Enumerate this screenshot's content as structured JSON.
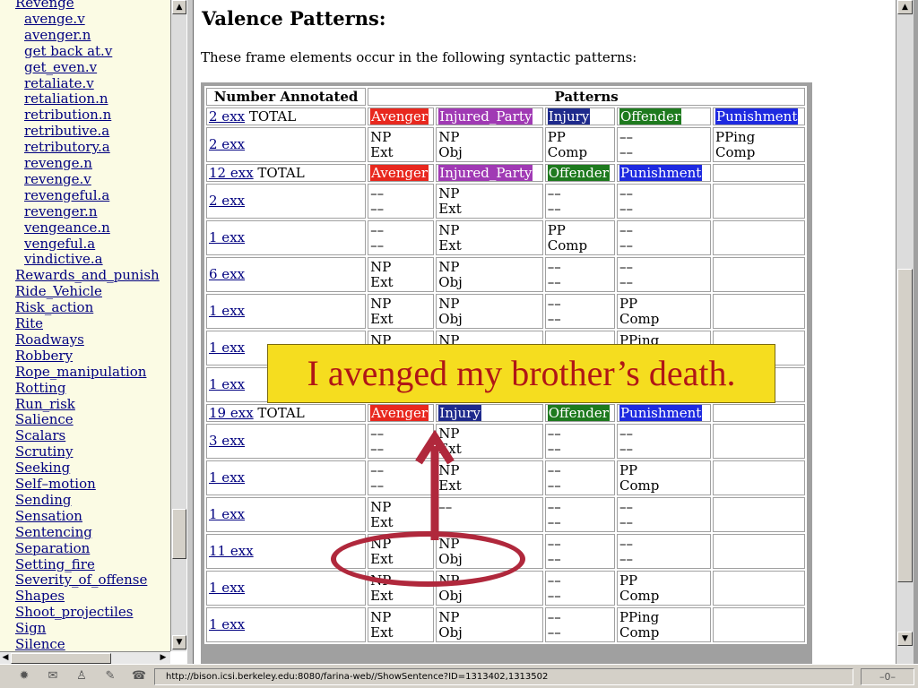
{
  "sidebar": {
    "items": [
      {
        "label": "Revenge",
        "sub": false
      },
      {
        "label": "avenge.v",
        "sub": true
      },
      {
        "label": "avenger.n",
        "sub": true
      },
      {
        "label": "get back at.v",
        "sub": true
      },
      {
        "label": "get_even.v",
        "sub": true
      },
      {
        "label": "retaliate.v",
        "sub": true
      },
      {
        "label": "retaliation.n",
        "sub": true
      },
      {
        "label": "retribution.n",
        "sub": true
      },
      {
        "label": "retributive.a",
        "sub": true
      },
      {
        "label": "retributory.a",
        "sub": true
      },
      {
        "label": "revenge.n",
        "sub": true
      },
      {
        "label": "revenge.v",
        "sub": true
      },
      {
        "label": "revengeful.a",
        "sub": true
      },
      {
        "label": "revenger.n",
        "sub": true
      },
      {
        "label": "vengeance.n",
        "sub": true
      },
      {
        "label": "vengeful.a",
        "sub": true
      },
      {
        "label": "vindictive.a",
        "sub": true
      },
      {
        "label": "Rewards_and_punish",
        "sub": false
      },
      {
        "label": "Ride_Vehicle",
        "sub": false
      },
      {
        "label": "Risk_action",
        "sub": false
      },
      {
        "label": "Rite",
        "sub": false
      },
      {
        "label": "Roadways",
        "sub": false
      },
      {
        "label": "Robbery",
        "sub": false
      },
      {
        "label": "Rope_manipulation",
        "sub": false
      },
      {
        "label": "Rotting",
        "sub": false
      },
      {
        "label": "Run_risk",
        "sub": false
      },
      {
        "label": "Salience",
        "sub": false
      },
      {
        "label": "Scalars",
        "sub": false
      },
      {
        "label": "Scrutiny",
        "sub": false
      },
      {
        "label": "Seeking",
        "sub": false
      },
      {
        "label": "Self–motion",
        "sub": false
      },
      {
        "label": "Sending",
        "sub": false
      },
      {
        "label": "Sensation",
        "sub": false
      },
      {
        "label": "Sentencing",
        "sub": false
      },
      {
        "label": "Separation",
        "sub": false
      },
      {
        "label": "Setting_fire",
        "sub": false
      },
      {
        "label": "Severity_of_offense",
        "sub": false
      },
      {
        "label": "Shapes",
        "sub": false
      },
      {
        "label": "Shoot_projectiles",
        "sub": false
      },
      {
        "label": "Sign",
        "sub": false
      },
      {
        "label": "Silence",
        "sub": false
      }
    ]
  },
  "main": {
    "title": "Valence Patterns:",
    "intro": "These frame elements occur in the following syntactic patterns:",
    "table": {
      "head_count": "Number Annotated",
      "head_patterns": "Patterns",
      "fe_colors": {
        "Avenger": "#e8281e",
        "Injured_Party": "#a03ab4",
        "Injury": "#1e2a8c",
        "Offender": "#1e7a1e",
        "Punishment": "#1e2ae0"
      },
      "rows": [
        {
          "kind": "sum",
          "link": "2 exx",
          "extra": " TOTAL",
          "cells": [
            "Avenger",
            "Injured_Party",
            "Injury",
            "Offender",
            "Punishment"
          ]
        },
        {
          "kind": "row",
          "link": "2 exx",
          "cells": [
            [
              "NP",
              "Ext"
            ],
            [
              "NP",
              "Obj"
            ],
            [
              "PP",
              "Comp"
            ],
            [
              "––",
              "––"
            ],
            [
              "PPing",
              "Comp"
            ]
          ]
        },
        {
          "kind": "sum",
          "link": "12 exx",
          "extra": " TOTAL",
          "cells": [
            "Avenger",
            "Injured_Party",
            "Offender",
            "Punishment",
            ""
          ]
        },
        {
          "kind": "row",
          "link": "2 exx",
          "cells": [
            [
              "––",
              "––"
            ],
            [
              "NP",
              "Ext"
            ],
            [
              "––",
              "––"
            ],
            [
              "––",
              "––"
            ],
            [
              "",
              ""
            ]
          ]
        },
        {
          "kind": "row",
          "link": "1 exx",
          "cells": [
            [
              "––",
              "––"
            ],
            [
              "NP",
              "Ext"
            ],
            [
              "PP",
              "Comp"
            ],
            [
              "––",
              "––"
            ],
            [
              "",
              ""
            ]
          ]
        },
        {
          "kind": "row",
          "link": "6 exx",
          "cells": [
            [
              "NP",
              "Ext"
            ],
            [
              "NP",
              "Obj"
            ],
            [
              "––",
              "––"
            ],
            [
              "––",
              "––"
            ],
            [
              "",
              ""
            ]
          ]
        },
        {
          "kind": "row",
          "link": "1 exx",
          "cells": [
            [
              "NP",
              "Ext"
            ],
            [
              "NP",
              "Obj"
            ],
            [
              "––",
              "––"
            ],
            [
              "PP",
              "Comp"
            ],
            [
              "",
              ""
            ]
          ]
        },
        {
          "kind": "row",
          "link": "1 exx",
          "cells": [
            [
              "NP",
              ""
            ],
            [
              "NP",
              ""
            ],
            [
              "",
              ""
            ],
            [
              "PPing",
              ""
            ],
            [
              "",
              ""
            ]
          ]
        },
        {
          "kind": "row",
          "link": "1 exx",
          "cells": [
            [
              "",
              ""
            ],
            [
              "",
              ""
            ],
            [
              "",
              ""
            ],
            [
              "",
              ""
            ],
            [
              "",
              ""
            ]
          ]
        },
        {
          "kind": "sum",
          "link": "19 exx",
          "extra": " TOTAL",
          "cells": [
            "Avenger",
            "Injury",
            "Offender",
            "Punishment",
            ""
          ]
        },
        {
          "kind": "row",
          "link": "3 exx",
          "cells": [
            [
              "––",
              "––"
            ],
            [
              "NP",
              "Ext"
            ],
            [
              "––",
              "––"
            ],
            [
              "––",
              "––"
            ],
            [
              "",
              ""
            ]
          ]
        },
        {
          "kind": "row",
          "link": "1 exx",
          "cells": [
            [
              "––",
              "––"
            ],
            [
              "NP",
              "Ext"
            ],
            [
              "––",
              "––"
            ],
            [
              "PP",
              "Comp"
            ],
            [
              "",
              ""
            ]
          ]
        },
        {
          "kind": "row",
          "link": "1 exx",
          "cells": [
            [
              "NP",
              "Ext"
            ],
            [
              "––",
              ""
            ],
            [
              "––",
              "––"
            ],
            [
              "––",
              "––"
            ],
            [
              "",
              ""
            ]
          ]
        },
        {
          "kind": "row",
          "link": "11 exx",
          "cells": [
            [
              "NP",
              "Ext"
            ],
            [
              "NP",
              "Obj"
            ],
            [
              "––",
              "––"
            ],
            [
              "––",
              "––"
            ],
            [
              "",
              ""
            ]
          ]
        },
        {
          "kind": "row",
          "link": "1 exx",
          "cells": [
            [
              "NP",
              "Ext"
            ],
            [
              "NP",
              "Obj"
            ],
            [
              "––",
              "––"
            ],
            [
              "PP",
              "Comp"
            ],
            [
              "",
              ""
            ]
          ]
        },
        {
          "kind": "row",
          "link": "1 exx",
          "cells": [
            [
              "NP",
              "Ext"
            ],
            [
              "NP",
              "Obj"
            ],
            [
              "––",
              "––"
            ],
            [
              "PPing",
              "Comp"
            ],
            [
              "",
              ""
            ]
          ]
        }
      ]
    }
  },
  "overlay": {
    "caption": "I avenged my brother’s death.",
    "highlight_color": "#b0283c",
    "caption_bg": "#f5dd1f"
  },
  "status": {
    "url": "http://bison.icsi.berkeley.edu:8080/farina-web//ShowSentence?ID=1313402,1313502",
    "connection": "–0–",
    "icons": [
      "netscape-icon",
      "mail-icon",
      "people-icon",
      "composer-icon",
      "conference-icon"
    ]
  }
}
